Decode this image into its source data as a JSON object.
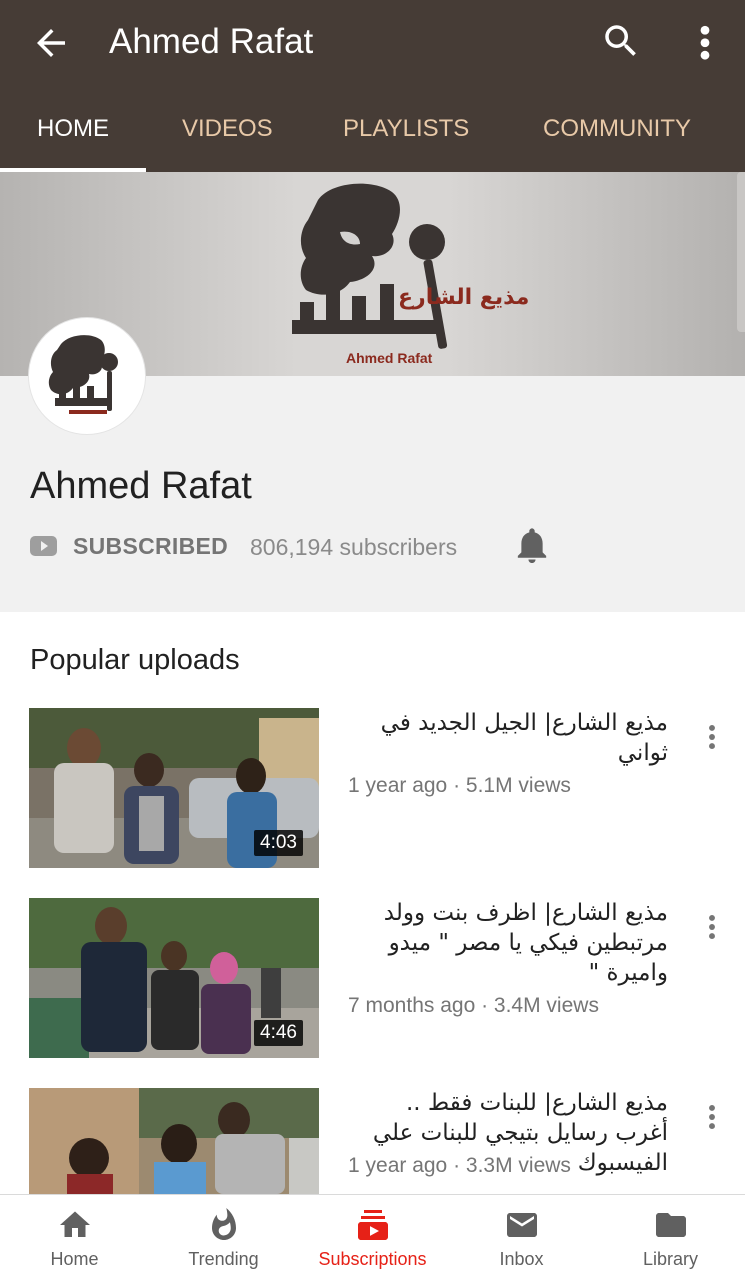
{
  "appbar": {
    "title": "Ahmed Rafat",
    "background_color": "#463c36",
    "back_icon": "arrow-left-icon",
    "search_icon": "search-icon",
    "more_icon": "more-vert-icon"
  },
  "tabs": [
    {
      "label": "HOME",
      "active": true
    },
    {
      "label": "VIDEOS",
      "active": false
    },
    {
      "label": "PLAYLISTS",
      "active": false
    },
    {
      "label": "COMMUNITY",
      "active": false
    }
  ],
  "banner": {
    "logo_arabic": "مذيع الشارع",
    "logo_latin": "Ahmed Rafat"
  },
  "channel": {
    "name": "Ahmed Rafat",
    "subscribe_status": "SUBSCRIBED",
    "subscribers": "806,194 subscribers",
    "bell_icon": "notification-bell-icon"
  },
  "section": {
    "title": "Popular uploads"
  },
  "videos": [
    {
      "title": "مذيع الشارع| الجيل الجديد في ثواني",
      "meta": "1 year ago · 5.1M views",
      "duration": "4:03"
    },
    {
      "title": "مذيع الشارع| اظرف بنت وولد مرتبطين فيكي يا مصر \" ميدو واميرة \"",
      "meta": "7 months ago · 3.4M views",
      "duration": "4:46"
    },
    {
      "title": "مذيع الشارع| للبنات فقط .. أغرب رسايل بتيجي للبنات علي الفيسبوك",
      "meta": "1 year ago · 3.3M views",
      "duration": ""
    }
  ],
  "bottom_nav": [
    {
      "label": "Home",
      "icon": "home-icon",
      "active": false
    },
    {
      "label": "Trending",
      "icon": "flame-icon",
      "active": false
    },
    {
      "label": "Subscriptions",
      "icon": "subscriptions-icon",
      "active": true
    },
    {
      "label": "Inbox",
      "icon": "mail-icon",
      "active": false
    },
    {
      "label": "Library",
      "icon": "folder-icon",
      "active": false
    }
  ],
  "colors": {
    "accent": "#e62117",
    "tab_inactive": "#e8c9a8",
    "header_bg": "#f1f1f1"
  }
}
